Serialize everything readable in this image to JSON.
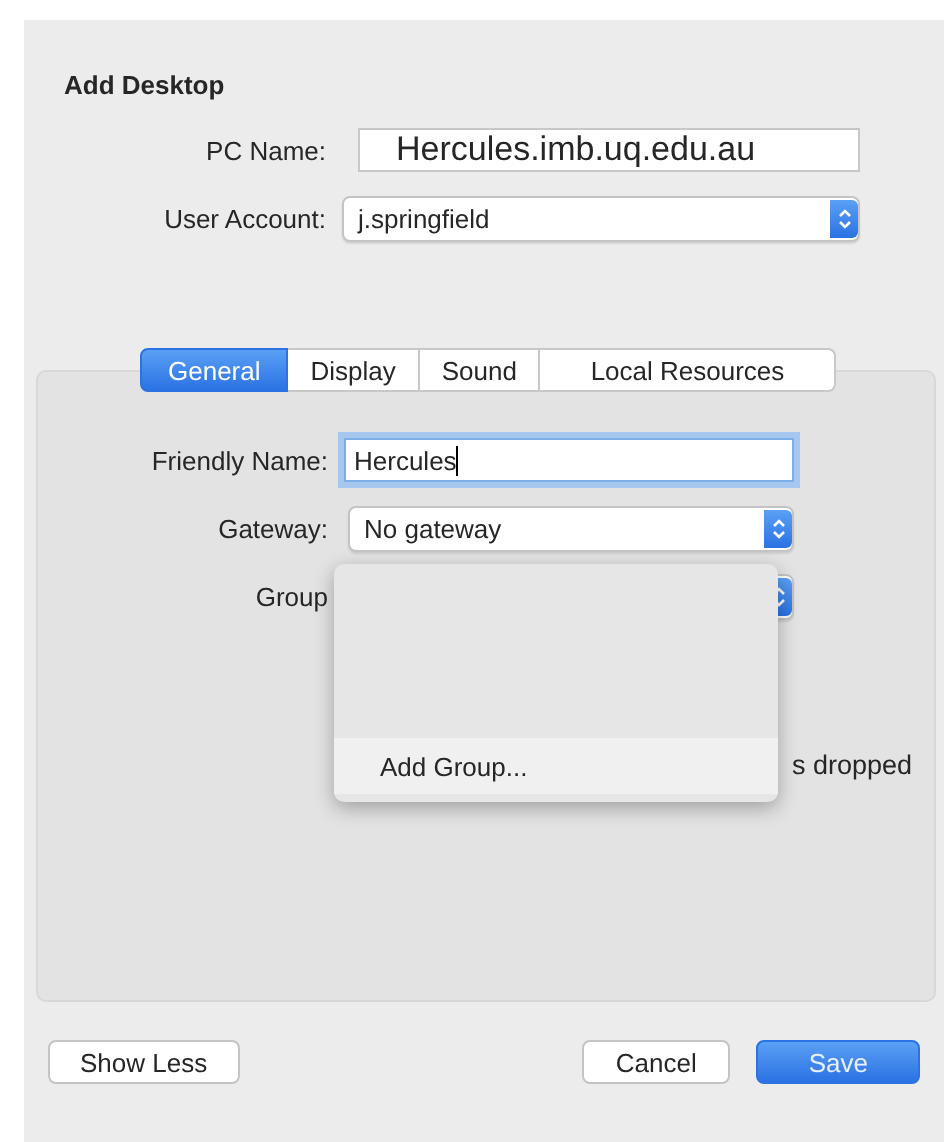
{
  "window": {
    "title": "Add Desktop"
  },
  "fields": [
    {
      "label": "PC Name:",
      "value": "Hercules.imb.uq.edu.au",
      "kind": "text",
      "focused": false
    },
    {
      "label": "User Account:",
      "value": "j.springfield",
      "kind": "popup"
    }
  ],
  "tabs": [
    {
      "label": "General",
      "selected": true
    },
    {
      "label": "Display",
      "selected": false
    },
    {
      "label": "Sound",
      "selected": false
    },
    {
      "label": "Local Resources",
      "selected": false
    }
  ],
  "general": {
    "fields": [
      {
        "label": "Friendly Name:",
        "value": "Hercules",
        "kind": "text",
        "focused": true
      },
      {
        "label": "Gateway:",
        "value": "No gateway",
        "kind": "popup"
      },
      {
        "label": "Group",
        "kind": "popup"
      }
    ],
    "note": "s dropped"
  },
  "menu": {
    "items": [
      {
        "label": "Add Group...",
        "highlighted": true
      }
    ]
  },
  "buttons": [
    {
      "label": "Show Less",
      "kind": "plain"
    },
    {
      "label": "Cancel",
      "kind": "plain"
    },
    {
      "label": "Save",
      "kind": "default"
    }
  ]
}
